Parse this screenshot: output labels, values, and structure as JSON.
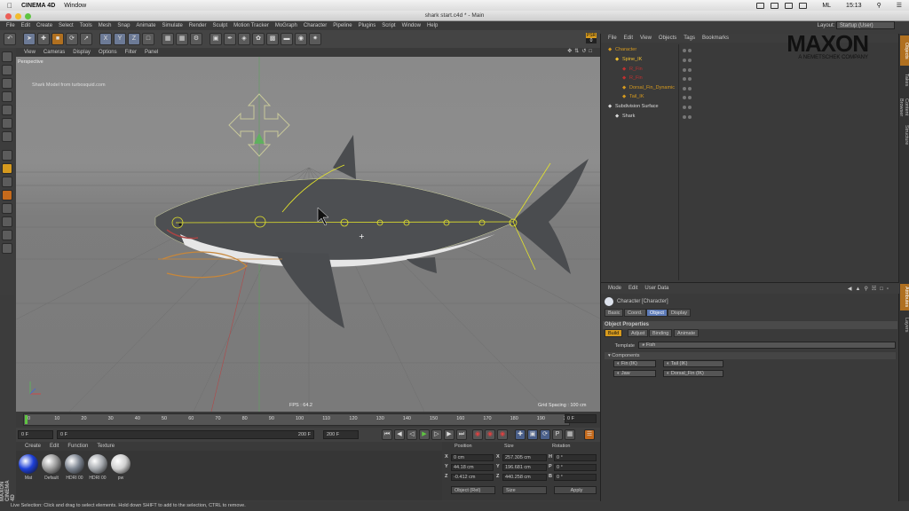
{
  "mac_menubar": {
    "app_name": "CINEMA 4D",
    "window_menu": "Window",
    "user": "ML",
    "time": "15:13"
  },
  "window": {
    "title": "shark start.c4d * - Main"
  },
  "main_menu": [
    "File",
    "Edit",
    "Create",
    "Select",
    "Tools",
    "Mesh",
    "Snap",
    "Animate",
    "Simulate",
    "Render",
    "Sculpt",
    "Motion Tracker",
    "MoGraph",
    "Character",
    "Pipeline",
    "Plugins",
    "Script",
    "Window",
    "Help"
  ],
  "toolbar": {
    "axes": [
      "X",
      "Y",
      "Z"
    ],
    "psr_badge": "PSR",
    "psr_value": "0"
  },
  "viewport": {
    "menu": [
      "View",
      "Cameras",
      "Display",
      "Options",
      "Filter",
      "Panel"
    ],
    "camera_label": "Perspective",
    "model_credit": "Shark Model from turbosquid.com",
    "fps": "FPS : 64.2",
    "grid_spacing": "Grid Spacing : 100 cm"
  },
  "timeline": {
    "ticks": [
      "0",
      "10",
      "20",
      "30",
      "40",
      "50",
      "60",
      "70",
      "80",
      "90",
      "100",
      "110",
      "120",
      "130",
      "140",
      "150",
      "160",
      "170",
      "180",
      "190",
      "200"
    ],
    "current_frame": "0 F",
    "start_field": "0 F",
    "min_field": "0 F",
    "max_field": "200 F",
    "end_field": "200 F"
  },
  "materials": {
    "menu": [
      "Create",
      "Edit",
      "Function",
      "Texture"
    ],
    "items": [
      {
        "name": "Mat",
        "color": "#1d3fd8"
      },
      {
        "name": "Default",
        "color": "#9a9a9a"
      },
      {
        "name": "HDRI 00",
        "color": "#7c8490"
      },
      {
        "name": "HDRI 00",
        "color": "#a4a8ad"
      },
      {
        "name": "pw",
        "color": "#cfcfcf"
      }
    ]
  },
  "coordinates": {
    "headers": [
      "Position",
      "Size",
      "Rotation"
    ],
    "rows": [
      {
        "axis": "X",
        "pos": "0 cm",
        "size_axis": "X",
        "size": "257.305 cm",
        "rot_axis": "H",
        "rot": "0 °"
      },
      {
        "axis": "Y",
        "pos": "44.18 cm",
        "size_axis": "Y",
        "size": "196.681 cm",
        "rot_axis": "P",
        "rot": "0 °"
      },
      {
        "axis": "Z",
        "pos": "-0.412 cm",
        "size_axis": "Z",
        "size": "440.258 cm",
        "rot_axis": "B",
        "rot": "0 °"
      }
    ],
    "mode_dropdown": "Object (Rel)",
    "size_dropdown": "Size",
    "apply_label": "Apply"
  },
  "status_text": "Live Selection: Click and drag to select elements. Hold down SHIFT to add to the selection, CTRL to remove.",
  "object_manager": {
    "menu": [
      "File",
      "Edit",
      "View",
      "Objects",
      "Tags",
      "Bookmarks"
    ],
    "objects": [
      {
        "name": "Character",
        "color": "#d69a1e"
      },
      {
        "name": "Spine_IK",
        "color": "#f0c030"
      },
      {
        "name": "R_Fin",
        "color": "#c03030"
      },
      {
        "name": "R_Fin",
        "color": "#c03030"
      },
      {
        "name": "Dorsal_Fin_Dynamic",
        "color": "#d69a1e"
      },
      {
        "name": "Tail_IK",
        "color": "#d69a1e"
      },
      {
        "name": "Subdivision Surface",
        "color": "#d8d8d8"
      },
      {
        "name": "Shark",
        "color": "#d8d8d8"
      }
    ],
    "brand": "MAXON",
    "brand_sub": "A NEMETSCHEK COMPANY",
    "layout_label": "Layout:",
    "layout_value": "Startup (User)"
  },
  "right_tabs": [
    "Objects",
    "Takes",
    "Content Browser",
    "Structure",
    "Attributes",
    "Layers"
  ],
  "attribute_manager": {
    "menu": [
      "Mode",
      "Edit",
      "User Data"
    ],
    "object_title": "Character [Character]",
    "tabs": [
      "Basic",
      "Coord.",
      "Object",
      "Display"
    ],
    "section": "Object Properties",
    "subtabs": [
      "Build",
      "Adjust",
      "Binding",
      "Animate"
    ],
    "template_label": "Template",
    "template_value": "Fish",
    "components_label": "Components",
    "components": [
      "Fin (IK)",
      "Tail (IK)",
      "Jaw",
      "Dorsal_Fin (IK)"
    ]
  }
}
